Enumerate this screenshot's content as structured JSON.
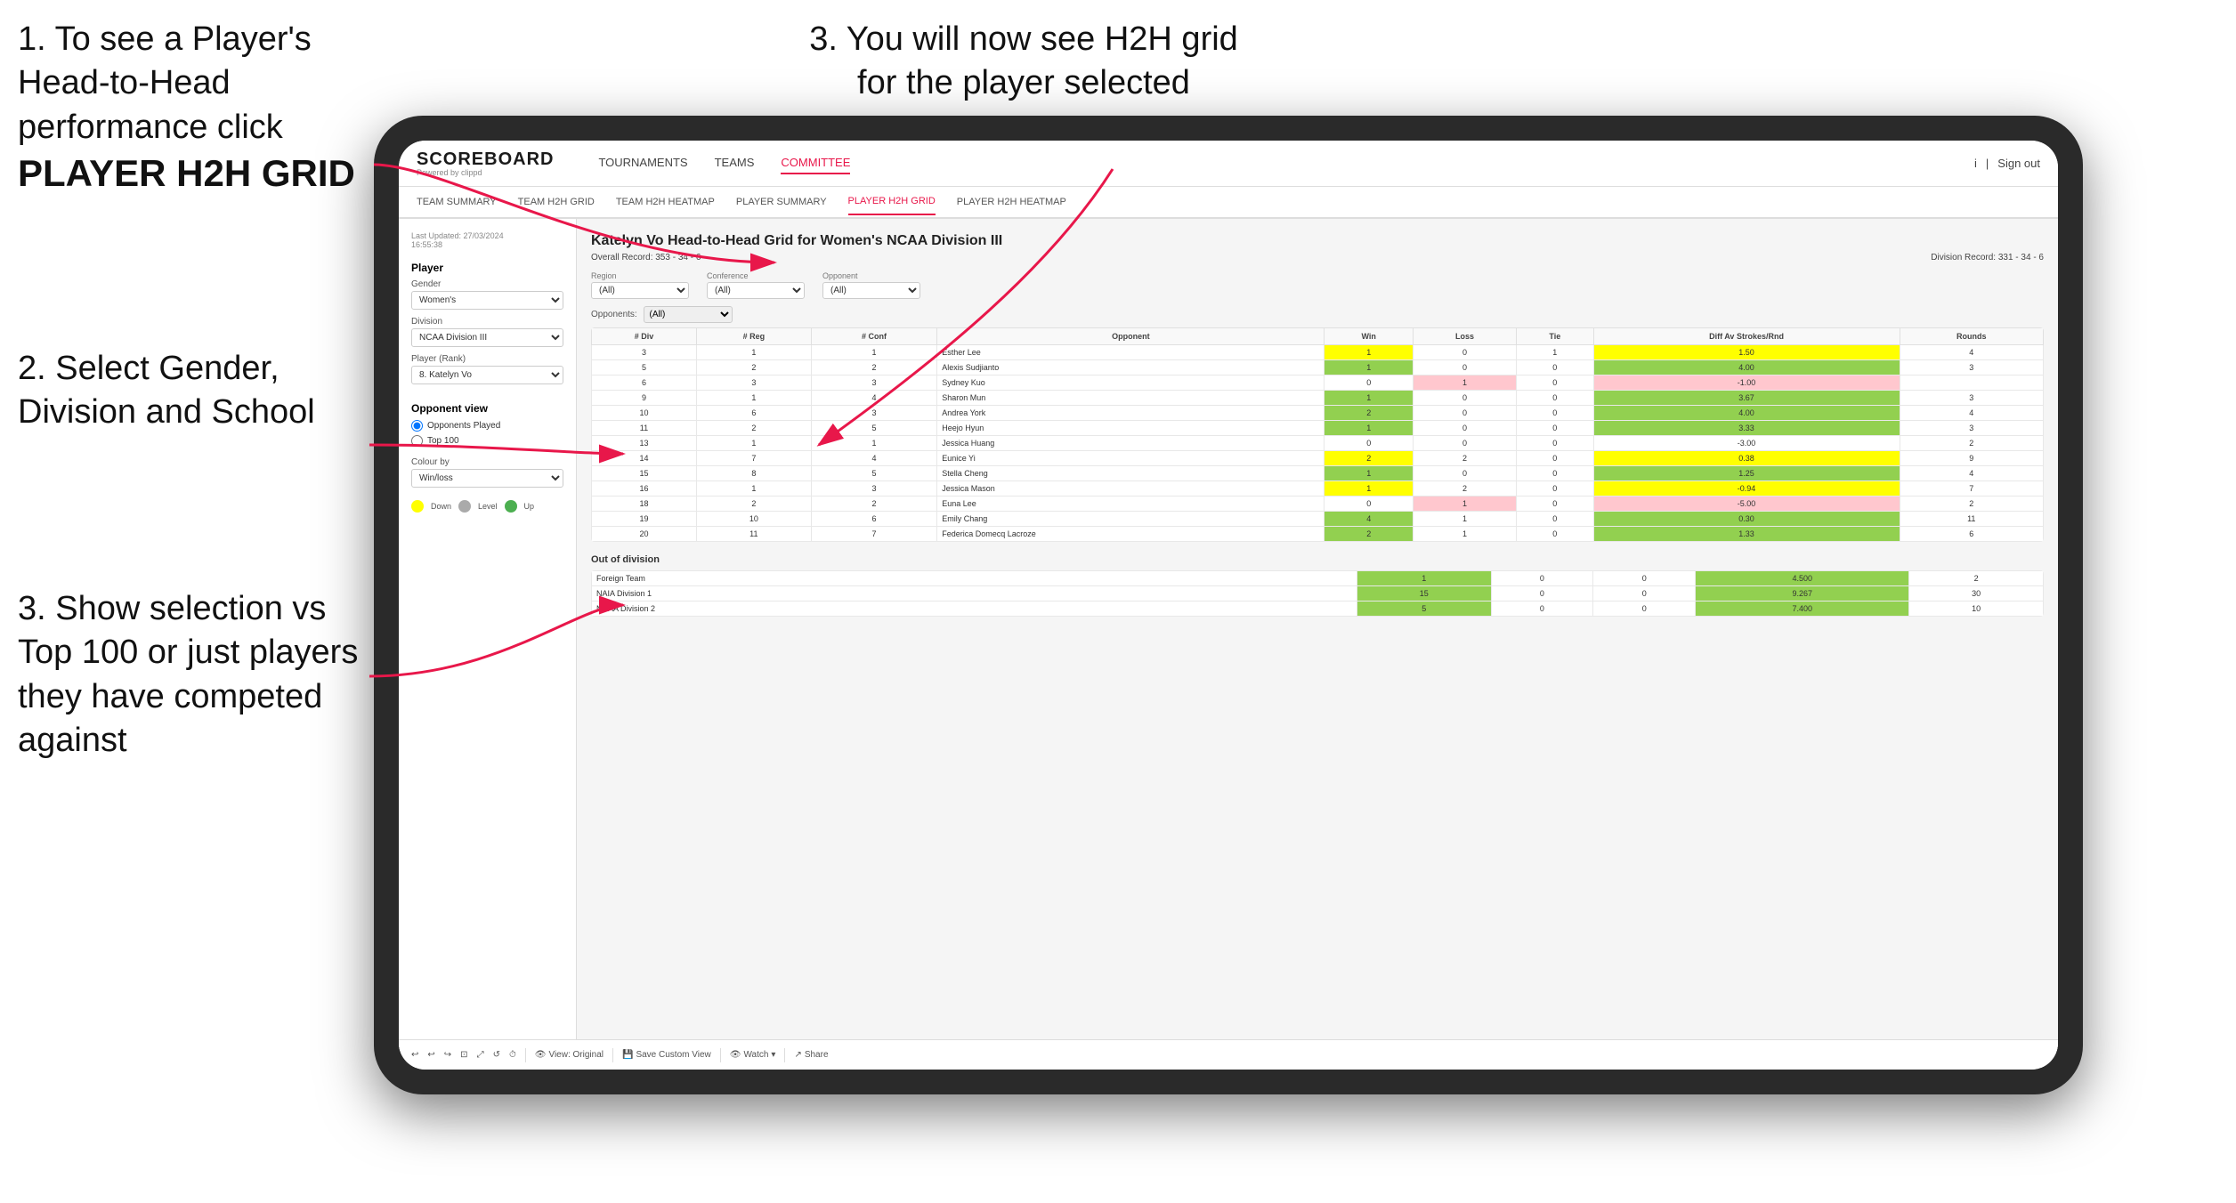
{
  "instructions": {
    "step1_title": "1. To see a Player's Head-to-Head performance click",
    "step1_bold": "PLAYER H2H GRID",
    "step3_title": "3. You will now see H2H grid for the player selected",
    "step2_title": "2. Select Gender, Division and School",
    "step3b_title": "3. Show selection vs Top 100 or just players they have competed against"
  },
  "navbar": {
    "logo": "SCOREBOARD",
    "logo_sub": "Powered by clippd",
    "nav_items": [
      "TOURNAMENTS",
      "TEAMS",
      "COMMITTEE"
    ],
    "active_nav": "COMMITTEE",
    "nav_right_icon": "i",
    "sign_out": "Sign out"
  },
  "subnav": {
    "items": [
      "TEAM SUMMARY",
      "TEAM H2H GRID",
      "TEAM H2H HEATMAP",
      "PLAYER SUMMARY",
      "PLAYER H2H GRID",
      "PLAYER H2H HEATMAP"
    ],
    "active": "PLAYER H2H GRID"
  },
  "left_panel": {
    "timestamp": "Last Updated: 27/03/2024",
    "timestamp2": "16:55:38",
    "player_section": "Player",
    "gender_label": "Gender",
    "gender_value": "Women's",
    "division_label": "Division",
    "division_value": "NCAA Division III",
    "player_rank_label": "Player (Rank)",
    "player_rank_value": "8. Katelyn Vo",
    "opponent_view_label": "Opponent view",
    "opponent_options": [
      "Opponents Played",
      "Top 100"
    ],
    "selected_opponent": "Opponents Played",
    "colour_by_label": "Colour by",
    "colour_by_value": "Win/loss",
    "legend_down": "Down",
    "legend_level": "Level",
    "legend_up": "Up"
  },
  "h2h": {
    "title": "Katelyn Vo Head-to-Head Grid for Women's NCAA Division III",
    "overall_record_label": "Overall Record:",
    "overall_record_value": "353 - 34 - 6",
    "division_record_label": "Division Record:",
    "division_record_value": "331 - 34 - 6",
    "region_label": "Region",
    "conference_label": "Conference",
    "opponent_label": "Opponent",
    "opponents_label": "Opponents:",
    "all_option": "(All)",
    "columns": [
      "# Div",
      "# Reg",
      "# Conf",
      "Opponent",
      "Win",
      "Loss",
      "Tie",
      "Diff Av Strokes/Rnd",
      "Rounds"
    ],
    "rows": [
      {
        "div": 3,
        "reg": 1,
        "conf": 1,
        "opponent": "Esther Lee",
        "win": 1,
        "loss": 0,
        "tie": 1,
        "diff": "1.50",
        "rounds": 4,
        "win_color": "yellow",
        "loss_color": "",
        "tie_color": "yellow"
      },
      {
        "div": 5,
        "reg": 2,
        "conf": 2,
        "opponent": "Alexis Sudjianto",
        "win": 1,
        "loss": 0,
        "tie": 0,
        "diff": "4.00",
        "rounds": 3,
        "win_color": "green"
      },
      {
        "div": 6,
        "reg": 3,
        "conf": 3,
        "opponent": "Sydney Kuo",
        "win": 0,
        "loss": 1,
        "tie": 0,
        "diff": "-1.00",
        "rounds": "",
        "win_color": "",
        "loss_color": "pink"
      },
      {
        "div": 9,
        "reg": 1,
        "conf": 4,
        "opponent": "Sharon Mun",
        "win": 1,
        "loss": 0,
        "tie": 0,
        "diff": "3.67",
        "rounds": 3,
        "win_color": "green"
      },
      {
        "div": 10,
        "reg": 6,
        "conf": 3,
        "opponent": "Andrea York",
        "win": 2,
        "loss": 0,
        "tie": 0,
        "diff": "4.00",
        "rounds": 4,
        "win_color": "green"
      },
      {
        "div": 11,
        "reg": 2,
        "conf": 5,
        "opponent": "Heejo Hyun",
        "win": 1,
        "loss": 0,
        "tie": 0,
        "diff": "3.33",
        "rounds": 3,
        "win_color": "green"
      },
      {
        "div": 13,
        "reg": 1,
        "conf": 1,
        "opponent": "Jessica Huang",
        "win": 0,
        "loss": 0,
        "tie": 0,
        "diff": "-3.00",
        "rounds": 2,
        "win_color": ""
      },
      {
        "div": 14,
        "reg": 7,
        "conf": 4,
        "opponent": "Eunice Yi",
        "win": 2,
        "loss": 2,
        "tie": 0,
        "diff": "0.38",
        "rounds": 9,
        "win_color": "yellow"
      },
      {
        "div": 15,
        "reg": 8,
        "conf": 5,
        "opponent": "Stella Cheng",
        "win": 1,
        "loss": 0,
        "tie": 0,
        "diff": "1.25",
        "rounds": 4,
        "win_color": "green"
      },
      {
        "div": 16,
        "reg": 1,
        "conf": 3,
        "opponent": "Jessica Mason",
        "win": 1,
        "loss": 2,
        "tie": 0,
        "diff": "-0.94",
        "rounds": 7,
        "win_color": "yellow"
      },
      {
        "div": 18,
        "reg": 2,
        "conf": 2,
        "opponent": "Euna Lee",
        "win": 0,
        "loss": 1,
        "tie": 0,
        "diff": "-5.00",
        "rounds": 2,
        "win_color": "",
        "loss_color": "pink"
      },
      {
        "div": 19,
        "reg": 10,
        "conf": 6,
        "opponent": "Emily Chang",
        "win": 4,
        "loss": 1,
        "tie": 0,
        "diff": "0.30",
        "rounds": 11,
        "win_color": "green"
      },
      {
        "div": 20,
        "reg": 11,
        "conf": 7,
        "opponent": "Federica Domecq Lacroze",
        "win": 2,
        "loss": 1,
        "tie": 0,
        "diff": "1.33",
        "rounds": 6,
        "win_color": "green"
      }
    ],
    "out_of_division_title": "Out of division",
    "out_of_division_rows": [
      {
        "name": "Foreign Team",
        "win": 1,
        "loss": 0,
        "tie": 0,
        "diff": "4.500",
        "rounds": 2
      },
      {
        "name": "NAIA Division 1",
        "win": 15,
        "loss": 0,
        "tie": 0,
        "diff": "9.267",
        "rounds": 30
      },
      {
        "name": "NCAA Division 2",
        "win": 5,
        "loss": 0,
        "tie": 0,
        "diff": "7.400",
        "rounds": 10
      }
    ]
  },
  "toolbar": {
    "view_original": "View: Original",
    "save_custom": "Save Custom View",
    "watch": "Watch",
    "share": "Share"
  },
  "colors": {
    "active_nav": "#e8174a",
    "green": "#92d050",
    "light_green": "#c6efce",
    "yellow": "#ffff00",
    "pink": "#ffc7ce",
    "legend_down": "#ffff00",
    "legend_level": "#aaaaaa",
    "legend_up": "#4caf50"
  }
}
